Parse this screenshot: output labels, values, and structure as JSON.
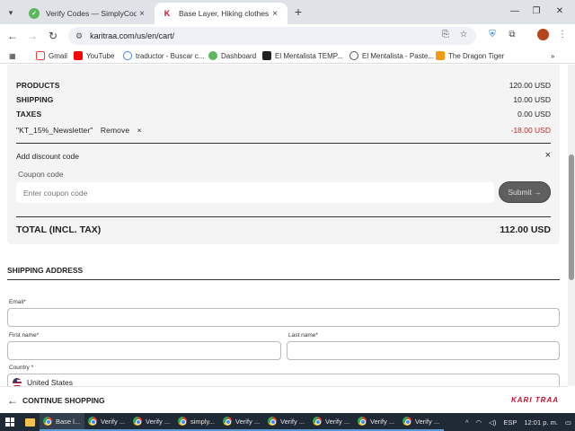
{
  "browser": {
    "tabs": [
      {
        "title": "Verify Codes — SimplyCodes",
        "favicon": "check-icon",
        "active": false
      },
      {
        "title": "Base Layer, Hiking clothes, wor",
        "favicon": "kari-traa-icon",
        "active": true
      }
    ],
    "url": "karitraa.com/us/en/cart/",
    "bookmarks": [
      {
        "label": "Gmail"
      },
      {
        "label": "YouTube"
      },
      {
        "label": "traductor - Buscar c..."
      },
      {
        "label": "Dashboard"
      },
      {
        "label": "El Mentalista TEMP..."
      },
      {
        "label": "El Mentalista - Paste..."
      },
      {
        "label": "The Dragon Tiger"
      }
    ]
  },
  "summary": {
    "products_label": "PRODUCTS",
    "products_value": "120.00 USD",
    "shipping_label": "SHIPPING",
    "shipping_value": "10.00 USD",
    "taxes_label": "TAXES",
    "taxes_value": "0.00 USD",
    "discount_code": "\"KT_15%_Newsletter\"",
    "remove_label": "Remove",
    "remove_x": "×",
    "discount_value": "-18.00 USD",
    "add_discount_label": "Add discount code",
    "close_x": "×",
    "coupon_label": "Coupon code",
    "coupon_placeholder": "Enter coupon code",
    "submit_label": "Submit →",
    "total_label": "TOTAL (INCL. TAX)",
    "total_value": "112.00 USD"
  },
  "shipping": {
    "title": "SHIPPING ADDRESS",
    "email_label": "Email*",
    "first_name_label": "First name*",
    "last_name_label": "Last name*",
    "country_label": "Country *",
    "country_value": "United States"
  },
  "footer": {
    "continue_label": "CONTINUE SHOPPING",
    "brand": "KARI TRAA"
  },
  "taskbar": {
    "apps": [
      "Base l...",
      "Verify ...",
      "Verify ...",
      "simply...",
      "Verify ...",
      "Verify ...",
      "Verify ...",
      "Verify ...",
      "Verify ..."
    ],
    "lang": "ESP",
    "time": "12:01 p. m."
  },
  "colors": {
    "discount": "#c62828",
    "brand": "#c8102e",
    "submit_bg": "#5f5f5f"
  }
}
